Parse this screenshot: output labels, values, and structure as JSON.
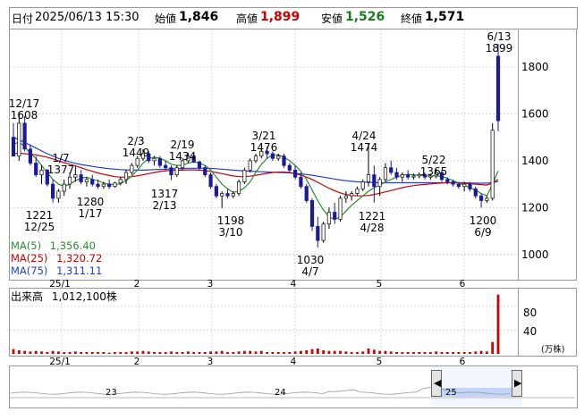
{
  "header": {
    "date_label": "日付",
    "date_value": "2025/06/13 15:30",
    "open_label": "始値",
    "open_value": "1,846",
    "high_label": "高値",
    "high_value": "1,899",
    "low_label": "安値",
    "low_value": "1,526",
    "close_label": "終値",
    "close_value": "1,571",
    "colors": {
      "high": "#cc0000",
      "low": "#1e7a1e",
      "neutral": "#000000"
    }
  },
  "ma_legend": [
    {
      "label": "MA(5)",
      "value": "1,356.40",
      "color": "#2e8b2e"
    },
    {
      "label": "MA(25)",
      "value": "1,320.72",
      "color": "#cc0000"
    },
    {
      "label": "MA(75)",
      "value": "1,311.11",
      "color": "#1f3fd6"
    }
  ],
  "volume": {
    "label": "出来高",
    "value": "1,012,100株",
    "unit": "(万株)",
    "y_ticks": [
      "80",
      "40"
    ]
  },
  "navigator": {
    "labels": [
      "23",
      "24",
      "25"
    ]
  },
  "chart_data": {
    "type": "candlestick",
    "y_axis": {
      "ticks": [
        1000,
        1200,
        1400,
        1600,
        1800
      ],
      "range": [
        900,
        1960
      ]
    },
    "x_axis": {
      "ticks": [
        "25/1",
        "2",
        "3",
        "4",
        "5",
        "6"
      ]
    },
    "annotations": [
      {
        "date": "12/17",
        "value": "1608"
      },
      {
        "date": "12/25",
        "value": "1221"
      },
      {
        "date": "1/7",
        "value": "1377"
      },
      {
        "date": "1/17",
        "value": "1280"
      },
      {
        "date": "2/3",
        "value": "1449"
      },
      {
        "date": "2/13",
        "value": "1317"
      },
      {
        "date": "2/19",
        "value": "1434"
      },
      {
        "date": "3/10",
        "value": "1198"
      },
      {
        "date": "3/21",
        "value": "1476"
      },
      {
        "date": "4/7",
        "value": "1030"
      },
      {
        "date": "4/24",
        "value": "1474"
      },
      {
        "date": "4/28",
        "value": "1221"
      },
      {
        "date": "5/22",
        "value": "1365"
      },
      {
        "date": "6/9",
        "value": "1200"
      },
      {
        "date": "6/13",
        "value": "1899"
      }
    ],
    "candles": [
      [
        1500,
        1560,
        1420,
        1420
      ],
      [
        1420,
        1608,
        1400,
        1560
      ],
      [
        1560,
        1590,
        1440,
        1450
      ],
      [
        1450,
        1470,
        1380,
        1390
      ],
      [
        1390,
        1420,
        1330,
        1340
      ],
      [
        1340,
        1380,
        1300,
        1360
      ],
      [
        1360,
        1365,
        1290,
        1300
      ],
      [
        1300,
        1320,
        1221,
        1240
      ],
      [
        1240,
        1280,
        1221,
        1270
      ],
      [
        1270,
        1320,
        1250,
        1300
      ],
      [
        1300,
        1350,
        1280,
        1330
      ],
      [
        1330,
        1377,
        1310,
        1340
      ],
      [
        1340,
        1360,
        1300,
        1310
      ],
      [
        1310,
        1330,
        1290,
        1320
      ],
      [
        1320,
        1340,
        1290,
        1300
      ],
      [
        1300,
        1320,
        1280,
        1290
      ],
      [
        1290,
        1310,
        1280,
        1300
      ],
      [
        1300,
        1320,
        1280,
        1290
      ],
      [
        1290,
        1310,
        1285,
        1305
      ],
      [
        1305,
        1330,
        1295,
        1320
      ],
      [
        1320,
        1360,
        1300,
        1350
      ],
      [
        1350,
        1390,
        1340,
        1380
      ],
      [
        1380,
        1420,
        1370,
        1410
      ],
      [
        1410,
        1449,
        1400,
        1430
      ],
      [
        1430,
        1440,
        1390,
        1400
      ],
      [
        1400,
        1420,
        1380,
        1410
      ],
      [
        1410,
        1420,
        1370,
        1380
      ],
      [
        1380,
        1400,
        1360,
        1370
      ],
      [
        1370,
        1380,
        1317,
        1340
      ],
      [
        1340,
        1380,
        1330,
        1370
      ],
      [
        1370,
        1410,
        1360,
        1400
      ],
      [
        1400,
        1434,
        1390,
        1420
      ],
      [
        1420,
        1430,
        1390,
        1395
      ],
      [
        1395,
        1400,
        1360,
        1370
      ],
      [
        1370,
        1380,
        1330,
        1340
      ],
      [
        1340,
        1350,
        1280,
        1290
      ],
      [
        1290,
        1300,
        1240,
        1250
      ],
      [
        1250,
        1270,
        1198,
        1260
      ],
      [
        1260,
        1280,
        1240,
        1250
      ],
      [
        1250,
        1270,
        1240,
        1260
      ],
      [
        1260,
        1320,
        1250,
        1310
      ],
      [
        1310,
        1370,
        1300,
        1360
      ],
      [
        1360,
        1410,
        1350,
        1400
      ],
      [
        1400,
        1430,
        1390,
        1420
      ],
      [
        1420,
        1476,
        1410,
        1440
      ],
      [
        1440,
        1460,
        1410,
        1430
      ],
      [
        1430,
        1440,
        1400,
        1410
      ],
      [
        1410,
        1430,
        1400,
        1420
      ],
      [
        1420,
        1430,
        1370,
        1380
      ],
      [
        1380,
        1390,
        1350,
        1360
      ],
      [
        1360,
        1380,
        1320,
        1330
      ],
      [
        1330,
        1350,
        1280,
        1290
      ],
      [
        1290,
        1300,
        1220,
        1230
      ],
      [
        1230,
        1240,
        1100,
        1120
      ],
      [
        1120,
        1160,
        1030,
        1060
      ],
      [
        1060,
        1140,
        1050,
        1130
      ],
      [
        1130,
        1200,
        1110,
        1180
      ],
      [
        1180,
        1220,
        1130,
        1150
      ],
      [
        1150,
        1250,
        1140,
        1240
      ],
      [
        1240,
        1270,
        1220,
        1250
      ],
      [
        1250,
        1270,
        1230,
        1260
      ],
      [
        1260,
        1290,
        1250,
        1280
      ],
      [
        1280,
        1320,
        1270,
        1310
      ],
      [
        1310,
        1474,
        1290,
        1340
      ],
      [
        1340,
        1380,
        1221,
        1290
      ],
      [
        1290,
        1330,
        1250,
        1320
      ],
      [
        1320,
        1390,
        1310,
        1370
      ],
      [
        1370,
        1400,
        1340,
        1350
      ],
      [
        1350,
        1370,
        1320,
        1330
      ],
      [
        1330,
        1350,
        1310,
        1340
      ],
      [
        1340,
        1360,
        1320,
        1330
      ],
      [
        1330,
        1345,
        1320,
        1335
      ],
      [
        1335,
        1350,
        1325,
        1340
      ],
      [
        1340,
        1350,
        1320,
        1330
      ],
      [
        1330,
        1345,
        1320,
        1335
      ],
      [
        1335,
        1365,
        1325,
        1350
      ],
      [
        1350,
        1360,
        1310,
        1320
      ],
      [
        1320,
        1330,
        1300,
        1310
      ],
      [
        1310,
        1320,
        1290,
        1300
      ],
      [
        1300,
        1310,
        1280,
        1290
      ],
      [
        1290,
        1310,
        1270,
        1300
      ],
      [
        1300,
        1310,
        1270,
        1280
      ],
      [
        1280,
        1290,
        1240,
        1250
      ],
      [
        1250,
        1260,
        1200,
        1230
      ],
      [
        1230,
        1250,
        1220,
        1240
      ],
      [
        1240,
        1560,
        1230,
        1530
      ],
      [
        1846,
        1899,
        1526,
        1571
      ]
    ],
    "ma5": [
      1470,
      1480,
      1460,
      1430,
      1410,
      1380,
      1350,
      1320,
      1300,
      1290,
      1300,
      1315,
      1325,
      1330,
      1320,
      1315,
      1305,
      1300,
      1298,
      1302,
      1315,
      1335,
      1360,
      1390,
      1410,
      1415,
      1410,
      1400,
      1385,
      1380,
      1380,
      1390,
      1395,
      1390,
      1380,
      1360,
      1330,
      1300,
      1280,
      1265,
      1270,
      1285,
      1310,
      1350,
      1385,
      1410,
      1425,
      1425,
      1415,
      1400,
      1380,
      1355,
      1320,
      1275,
      1230,
      1190,
      1160,
      1150,
      1160,
      1185,
      1210,
      1230,
      1250,
      1270,
      1285,
      1295,
      1310,
      1320,
      1330,
      1338,
      1342,
      1340,
      1338,
      1336,
      1335,
      1335,
      1333,
      1325,
      1315,
      1305,
      1295,
      1285,
      1275,
      1260,
      1250,
      1300,
      1356
    ],
    "ma25": [
      1430,
      1432,
      1430,
      1428,
      1425,
      1420,
      1415,
      1408,
      1400,
      1392,
      1385,
      1378,
      1370,
      1362,
      1355,
      1348,
      1342,
      1337,
      1332,
      1330,
      1330,
      1332,
      1336,
      1340,
      1345,
      1350,
      1354,
      1357,
      1359,
      1360,
      1360,
      1361,
      1361,
      1360,
      1358,
      1355,
      1350,
      1345,
      1340,
      1335,
      1332,
      1332,
      1334,
      1338,
      1342,
      1346,
      1350,
      1352,
      1352,
      1350,
      1345,
      1338,
      1330,
      1320,
      1308,
      1295,
      1283,
      1272,
      1263,
      1256,
      1252,
      1250,
      1250,
      1252,
      1256,
      1261,
      1267,
      1273,
      1279,
      1285,
      1290,
      1294,
      1297,
      1299,
      1301,
      1303,
      1305,
      1306,
      1306,
      1305,
      1304,
      1302,
      1300,
      1298,
      1296,
      1305,
      1320
    ],
    "ma75": [
      1500,
      1490,
      1478,
      1466,
      1454,
      1442,
      1430,
      1420,
      1410,
      1402,
      1395,
      1389,
      1384,
      1380,
      1376,
      1372,
      1369,
      1366,
      1364,
      1362,
      1361,
      1360,
      1360,
      1360,
      1361,
      1362,
      1363,
      1364,
      1365,
      1366,
      1367,
      1368,
      1368,
      1368,
      1368,
      1367,
      1366,
      1364,
      1362,
      1360,
      1358,
      1356,
      1355,
      1354,
      1353,
      1352,
      1351,
      1350,
      1349,
      1348,
      1346,
      1344,
      1341,
      1338,
      1334,
      1330,
      1326,
      1322,
      1318,
      1315,
      1312,
      1310,
      1309,
      1308,
      1307,
      1306,
      1306,
      1306,
      1306,
      1306,
      1306,
      1306,
      1306,
      1306,
      1306,
      1306,
      1306,
      1306,
      1306,
      1306,
      1306,
      1305,
      1305,
      1304,
      1304,
      1307,
      1311
    ],
    "volumes": [
      8,
      6,
      5,
      4,
      5,
      4,
      3,
      5,
      4,
      3,
      3,
      4,
      3,
      3,
      3,
      3,
      3,
      2,
      3,
      3,
      3,
      4,
      4,
      5,
      4,
      3,
      3,
      3,
      4,
      3,
      3,
      4,
      3,
      3,
      3,
      4,
      4,
      5,
      3,
      3,
      4,
      5,
      5,
      4,
      5,
      3,
      3,
      3,
      3,
      3,
      4,
      5,
      6,
      8,
      9,
      6,
      5,
      5,
      5,
      4,
      3,
      3,
      4,
      9,
      7,
      5,
      5,
      4,
      3,
      3,
      3,
      3,
      3,
      3,
      3,
      4,
      3,
      3,
      3,
      3,
      3,
      3,
      4,
      5,
      4,
      20,
      100
    ],
    "volume_y_ticks": [
      40,
      80
    ]
  }
}
